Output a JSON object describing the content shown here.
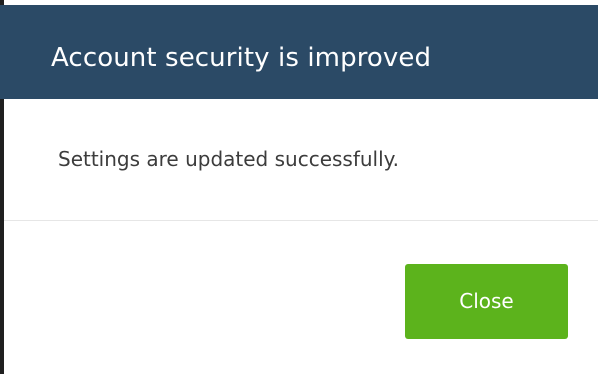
{
  "dialog": {
    "title": "Account security is improved",
    "message": "Settings are updated successfully.",
    "close_label": "Close"
  },
  "colors": {
    "header_background": "#2b4a66",
    "button_background": "#5cb31c",
    "text": "#3c3c3c"
  }
}
